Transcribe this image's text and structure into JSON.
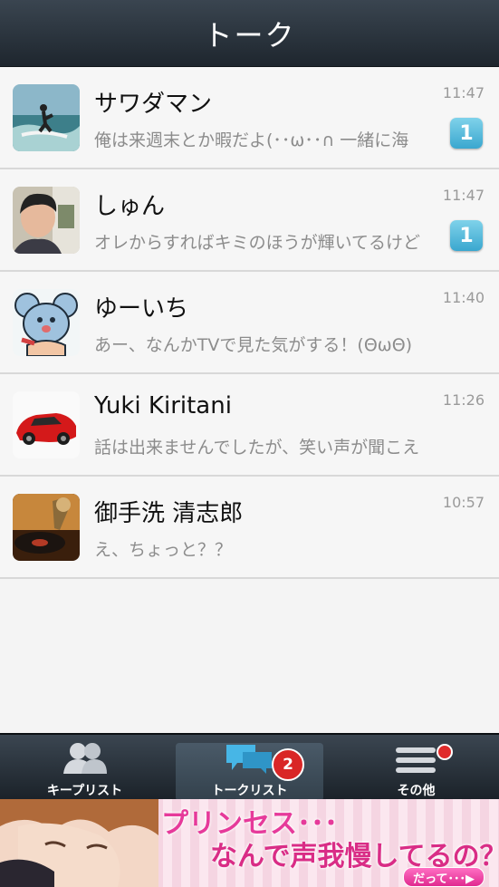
{
  "header": {
    "title": "トーク"
  },
  "chats": [
    {
      "name": "サワダマン",
      "preview": "俺は来週末とか暇だよ(･･ω･･∩  一緒に海",
      "time": "11:47",
      "unread": "1",
      "avatar": "surfer-photo"
    },
    {
      "name": "しゅん",
      "preview": "オレからすればキミのほうが輝いてるけど",
      "time": "11:47",
      "unread": "1",
      "avatar": "person-photo"
    },
    {
      "name": "ゆーいち",
      "preview": "あー、なんかTVで見た気がする！(ΘωΘ)",
      "time": "11:40",
      "unread": "",
      "avatar": "mouse-character"
    },
    {
      "name": "Yuki Kiritani",
      "preview": "話は出来ませんでしたが、笑い声が聞こえ",
      "time": "11:26",
      "unread": "",
      "avatar": "red-sports-car"
    },
    {
      "name": "御手洗 清志郎",
      "preview": "え、ちょっと？？",
      "time": "10:57",
      "unread": "",
      "avatar": "record-player"
    }
  ],
  "tabbar": {
    "tabs": [
      {
        "label": "キープリスト",
        "icon": "people-icon"
      },
      {
        "label": "トークリスト",
        "icon": "chat-bubbles-icon",
        "badge": "2"
      },
      {
        "label": "その他",
        "icon": "menu-lines-icon"
      }
    ]
  },
  "ad": {
    "line1": "プリンセス･･･",
    "line2": "なんで声我慢してるの？",
    "cta": "だって･･･▶"
  }
}
